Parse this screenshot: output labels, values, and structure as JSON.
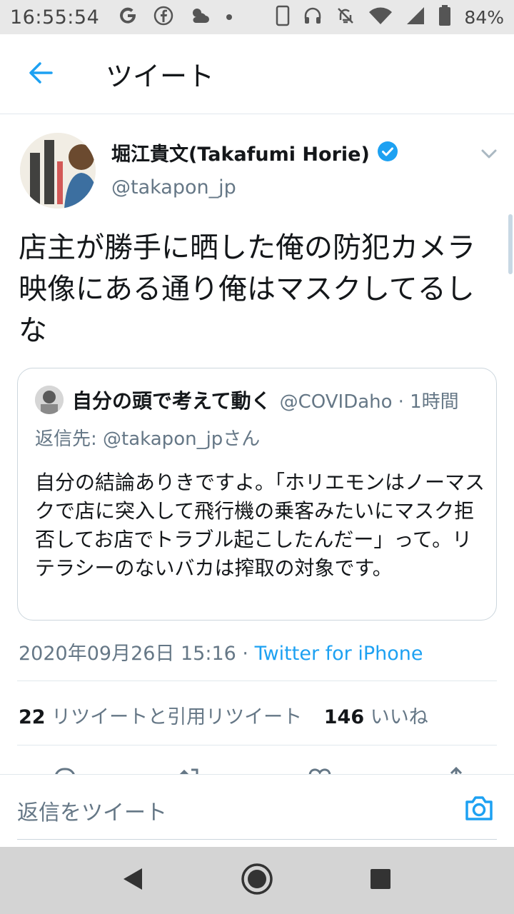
{
  "status_bar": {
    "time": "16:55:54",
    "battery": "84%",
    "icons": [
      "google-icon",
      "facebook-icon",
      "weather-icon",
      "dot-icon",
      "phone-icon",
      "headset-icon",
      "mute-icon",
      "wifi-icon",
      "signal-icon",
      "battery-icon"
    ]
  },
  "header": {
    "title": "ツイート",
    "back_icon": "back-arrow-icon"
  },
  "tweet": {
    "author_name": "堀江貴文(Takafumi Horie)",
    "handle": "@takapon_jp",
    "verified": true,
    "text": "店主が勝手に晒した俺の防犯カメラ映像にある通り俺はマスクしてるしな",
    "timestamp": "2020年09月26日 15:16",
    "separator": " · ",
    "source": "Twitter for iPhone",
    "retweets_count": "22",
    "retweets_label": "リツイートと引用リツイート",
    "likes_count": "146",
    "likes_label": "いいね"
  },
  "quote": {
    "author_name": "自分の頭で考えて動く",
    "handle": "@COVIDaho",
    "time": "· 1時間",
    "reply_to": "返信先: @takapon_jpさん",
    "text": "自分の結論ありきですよ。「ホリエモンはノーマスクで店に突入して飛行機の乗客みたいにマスク拒否してお店でトラブル起こしたんだー」って。リテラシーのないバカは搾取の対象です。"
  },
  "reply_bar": {
    "placeholder": "返信をツイート"
  },
  "colors": {
    "accent": "#1da1f2",
    "secondary_text": "#657786",
    "divider": "#e1e8ed"
  }
}
